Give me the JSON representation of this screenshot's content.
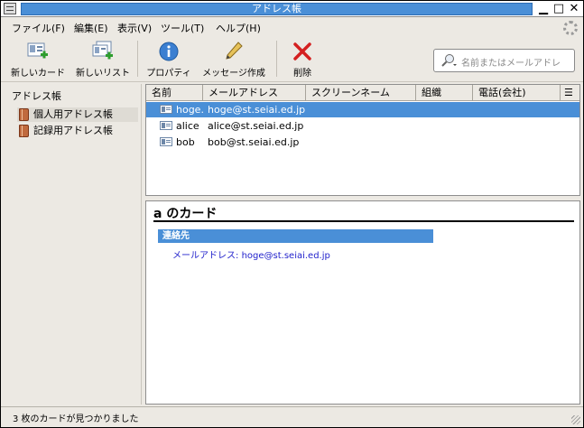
{
  "window": {
    "title": "アドレス帳"
  },
  "menubar": {
    "items": [
      {
        "label": "ファイル(F)"
      },
      {
        "label": "編集(E)"
      },
      {
        "label": "表示(V)"
      },
      {
        "label": "ツール(T)"
      },
      {
        "label": "ヘルプ(H)"
      }
    ]
  },
  "toolbar": {
    "new_card": "新しいカード",
    "new_list": "新しいリスト",
    "properties": "プロパティ",
    "compose": "メッセージ作成",
    "delete": "削除"
  },
  "search": {
    "placeholder": "名前またはメールアドレ"
  },
  "sidebar": {
    "header": "アドレス帳",
    "items": [
      {
        "label": "個人用アドレス帳",
        "selected": true
      },
      {
        "label": "記録用アドレス帳",
        "selected": false
      }
    ]
  },
  "list": {
    "columns": [
      "名前",
      "メールアドレス",
      "スクリーンネーム",
      "組織",
      "電話(会社)"
    ],
    "rows": [
      {
        "name": "hoge...",
        "email": "hoge@st.seiai.ed.jp",
        "selected": true
      },
      {
        "name": "alice",
        "email": "alice@st.seiai.ed.jp",
        "selected": false
      },
      {
        "name": "bob",
        "email": "bob@st.seiai.ed.jp",
        "selected": false
      }
    ]
  },
  "card": {
    "title": "a のカード",
    "section": "連絡先",
    "email_label": "メールアドレス:",
    "email_value": "hoge@st.seiai.ed.jp"
  },
  "status": {
    "text": "3 枚のカードが見つかりました"
  },
  "colors": {
    "selection": "#4a8fd7",
    "link": "#2222cc",
    "chrome": "#ece9e3"
  }
}
